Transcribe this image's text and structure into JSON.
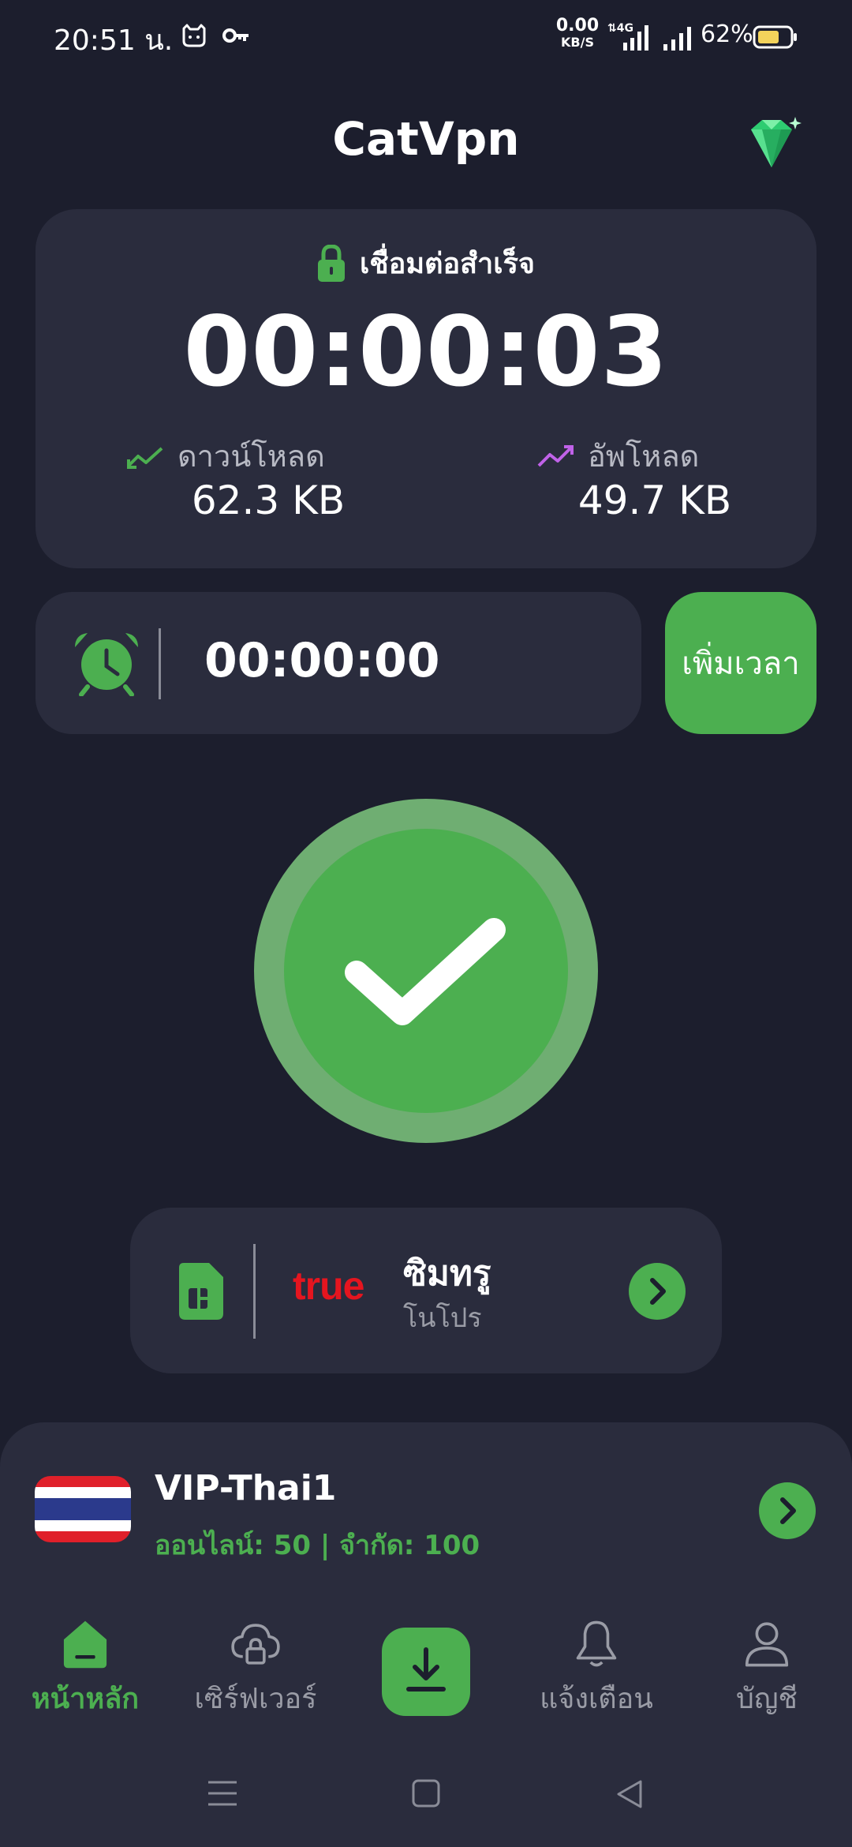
{
  "status_bar": {
    "time": "20:51 น.",
    "net_speed_value": "0.00",
    "net_speed_unit": "KB/S",
    "battery_percent": "62%"
  },
  "header": {
    "title": "CatVpn",
    "premium_icon": "gem-icon"
  },
  "connection": {
    "status": "เชื่อมต่อสำเร็จ",
    "elapsed": "00:00:03",
    "download_label": "ดาวน์โหลด",
    "download_value": "62.3 KB",
    "upload_label": "อัพโหลด",
    "upload_value": "49.7 KB"
  },
  "time_card": {
    "remaining": "00:00:00",
    "add_time_label": "เพิ่มเวลา"
  },
  "network": {
    "carrier_logo": "true",
    "name": "ซิมทรู",
    "package": "โนโปร"
  },
  "server": {
    "name": "VIP-Thai1",
    "stats": "ออนไลน์: 50 | จำกัด: 100"
  },
  "nav": {
    "home": "หน้าหลัก",
    "servers": "เซิร์ฟเวอร์",
    "notifications": "แจ้งเตือน",
    "account": "บัญชี"
  },
  "colors": {
    "background": "#1c1e2d",
    "card": "#2a2c3d",
    "accent": "#4caf50",
    "upload_accent": "#c062e8",
    "true_red": "#e5151f"
  }
}
